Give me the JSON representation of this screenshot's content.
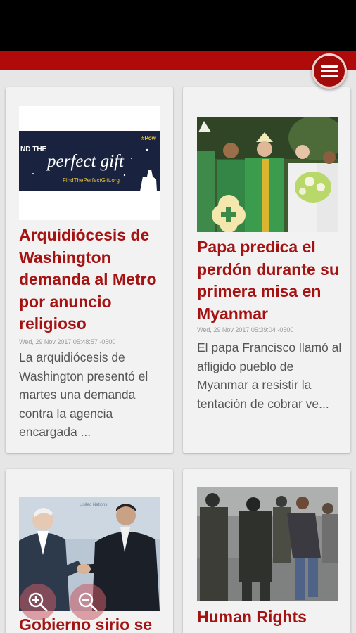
{
  "menu": {
    "icon": "hamburger-menu-icon"
  },
  "articles": [
    {
      "title": "Arquidiócesis de Washington demanda al Metro por anuncio religioso",
      "date": "Wed, 29 Nov 2017 05:48:57 -0500",
      "summary": "La arquidiócesis de Washington presentó el martes una demanda contra la agencia encargada ...",
      "image_text": {
        "line1": "ND THE",
        "line2": "perfect gift",
        "url": "FindThePerfectGift.org",
        "tag": "#Pow"
      }
    },
    {
      "title": "Papa predica el perdón durante su primera misa en Myanmar",
      "date": "Wed, 29 Nov 2017 05:39:04 -0500",
      "summary": "El papa Francisco llamó al afligido pueblo de Myanmar a resistir la tentación de cobrar ve..."
    },
    {
      "title": "Gobierno sirio se",
      "image_text": {
        "banner": "United Nations"
      }
    },
    {
      "title": "Human Rights"
    }
  ],
  "controls": {
    "zoom_in": "zoom-in-icon",
    "zoom_out": "zoom-out-icon"
  }
}
